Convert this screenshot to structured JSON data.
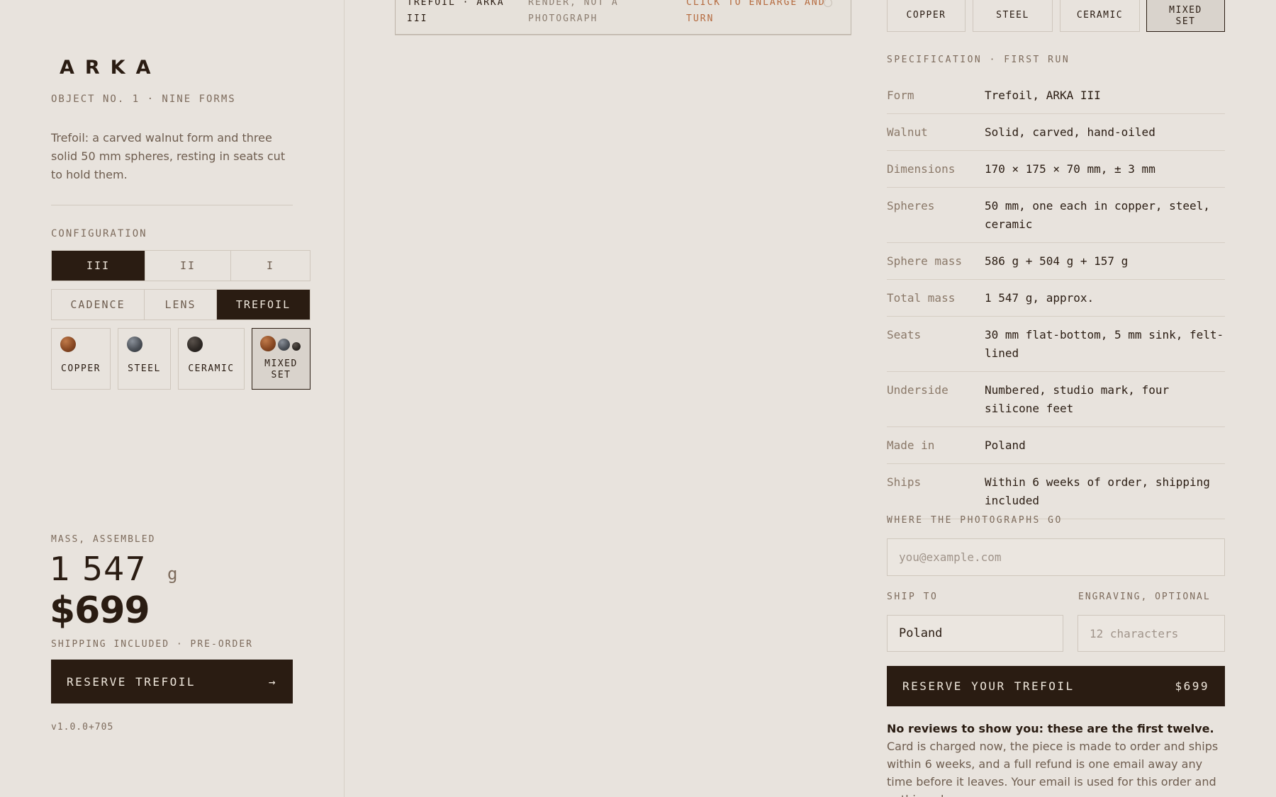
{
  "brand": "ARKA",
  "object_line": "OBJECT NO. 1 · NINE FORMS",
  "description": "Trefoil: a carved walnut form and three solid 50 mm spheres, resting in seats cut to hold them.",
  "configuration": {
    "label": "CONFIGURATION",
    "counts": [
      {
        "label": "III",
        "active": true
      },
      {
        "label": "II",
        "active": false
      },
      {
        "label": "I",
        "active": false
      }
    ],
    "forms": [
      {
        "label": "CADENCE",
        "active": false
      },
      {
        "label": "LENS",
        "active": false
      },
      {
        "label": "TREFOIL",
        "active": true
      }
    ],
    "spheres": [
      {
        "label": "COPPER",
        "active": false,
        "icon": "copper-sphere-icon"
      },
      {
        "label": "STEEL",
        "active": false,
        "icon": "steel-sphere-icon"
      },
      {
        "label": "CERAMIC",
        "active": false,
        "icon": "ceramic-sphere-icon"
      },
      {
        "label_line1": "MIXED",
        "label_line2": "SET",
        "active": true,
        "icon": "mixed-spheres-icon"
      }
    ]
  },
  "colors": {
    "copper": "#8a4a24",
    "steel": "#4d5259",
    "ceramic": "#2f2a26",
    "dark": "#2a1c12",
    "accent": "#b56a3e"
  },
  "summary": {
    "mass_label": "MASS, ASSEMBLED",
    "mass_value": "1 547",
    "mass_unit": "g",
    "price": "$699",
    "shipping_note": "SHIPPING INCLUDED · PRE-ORDER",
    "reserve_label": "RESERVE TREFOIL",
    "reserve_arrow": "→",
    "version": "v1.0.0+705"
  },
  "caption": {
    "name": "TREFOIL · ARKA III",
    "note": "RENDER, NOT A PHOTOGRAPH",
    "action": "CLICK TO ENLARGE AND TURN",
    "icon": "zoom-icon"
  },
  "top_spheres": [
    {
      "label": "COPPER",
      "active": false
    },
    {
      "label": "STEEL",
      "active": false
    },
    {
      "label": "CERAMIC",
      "active": false
    },
    {
      "label_line1": "MIXED",
      "label_line2": "SET",
      "active": true
    }
  ],
  "spec": {
    "title": "SPECIFICATION · FIRST RUN",
    "rows": [
      {
        "key": "Form",
        "value": "Trefoil, ARKA III"
      },
      {
        "key": "Walnut",
        "value": "Solid, carved, hand-oiled"
      },
      {
        "key": "Dimensions",
        "value": "170 × 175 × 70 mm, ± 3 mm"
      },
      {
        "key": "Spheres",
        "value": "50 mm, one each in copper, steel, ceramic"
      },
      {
        "key": "Sphere mass",
        "value": "586 g + 504 g + 157 g"
      },
      {
        "key": "Total mass",
        "value": "1 547 g, approx."
      },
      {
        "key": "Seats",
        "value": "30 mm flat-bottom, 5 mm sink, felt-lined"
      },
      {
        "key": "Underside",
        "value": "Numbered, studio mark, four silicone feet"
      },
      {
        "key": "Made in",
        "value": "Poland"
      },
      {
        "key": "Ships",
        "value": "Within 6 weeks of order, shipping included"
      }
    ]
  },
  "order": {
    "email_label": "WHERE THE PHOTOGRAPHS GO",
    "email_placeholder": "you@example.com",
    "ship_label": "SHIP TO",
    "ship_value": "Poland",
    "engraving_label": "ENGRAVING, OPTIONAL",
    "engraving_placeholder": "12 characters",
    "reserve_label": "RESERVE YOUR TREFOIL",
    "reserve_price": "$699",
    "fineprint_bold": "No reviews to show you: these are the first twelve.",
    "fineprint_rest": " Card is charged now, the piece is made to order and ships within 6 weeks, and a full refund is one email away any time before it leaves. Your email is used for this order and nothing else."
  }
}
